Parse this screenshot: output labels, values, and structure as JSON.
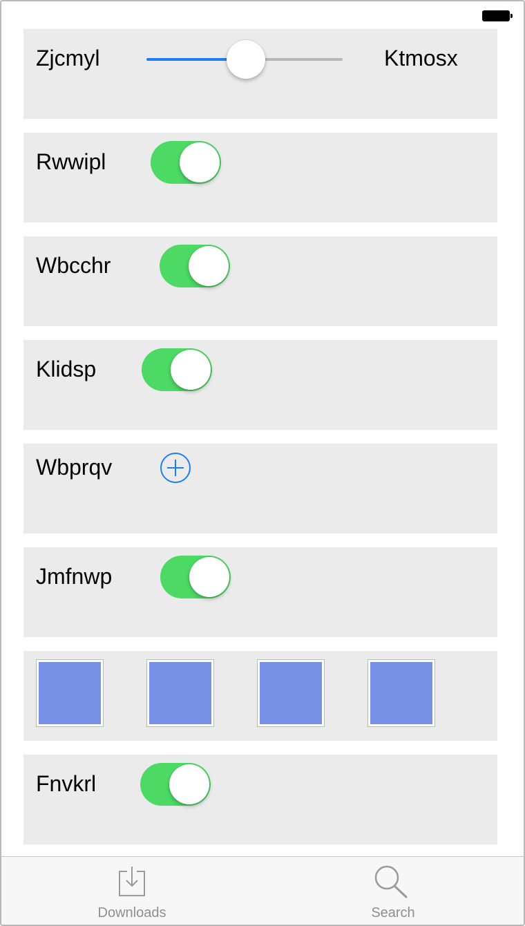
{
  "status_bar": {
    "battery_icon": "battery-full-icon"
  },
  "rows": {
    "slider_row": {
      "min_label": "Zjcmyl",
      "max_label": "Ktmosx",
      "value_fraction": 0.5
    },
    "toggle_1": {
      "label": "Rwwipl",
      "on": true
    },
    "toggle_2": {
      "label": "Wbcchr",
      "on": true
    },
    "toggle_3": {
      "label": "Klidsp",
      "on": true
    },
    "add_row": {
      "label": "Wbprqv",
      "icon": "add-circle-icon"
    },
    "toggle_4": {
      "label": "Jmfnwp",
      "on": true
    },
    "swatches": {
      "count": 4,
      "color": "#7890e4"
    },
    "toggle_5": {
      "label": "Fnvkrl",
      "on": true
    }
  },
  "tabbar": {
    "tabs": [
      {
        "label": "Downloads",
        "icon": "download-tray-icon"
      },
      {
        "label": "Search",
        "icon": "search-icon"
      }
    ]
  },
  "colors": {
    "accent": "#1e7cf2",
    "toggle_on": "#4cd964",
    "row_background": "#ebebeb"
  }
}
